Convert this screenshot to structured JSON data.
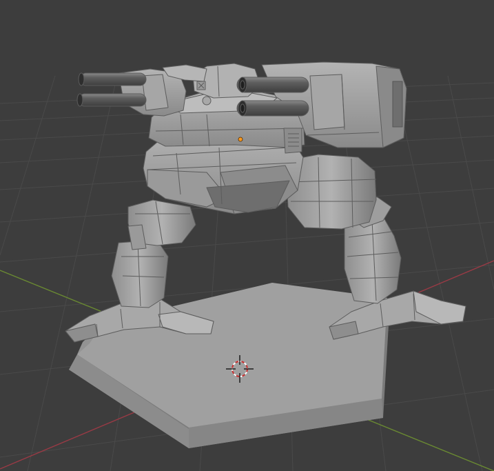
{
  "viewport": {
    "kind": "3d-viewport",
    "background_color": "#3d3d3d",
    "grid_color": "#4a4a4a",
    "x_axis_color": "#9a3a45",
    "y_axis_color": "#6a8a32",
    "model_color": "#a0a0a0",
    "origin_color": "#ff9a1f"
  },
  "scene": {
    "object": "mech-model-on-hex-base",
    "cursor_icon": "3d-cursor-icon",
    "origin_icon": "object-origin-dot-icon"
  }
}
